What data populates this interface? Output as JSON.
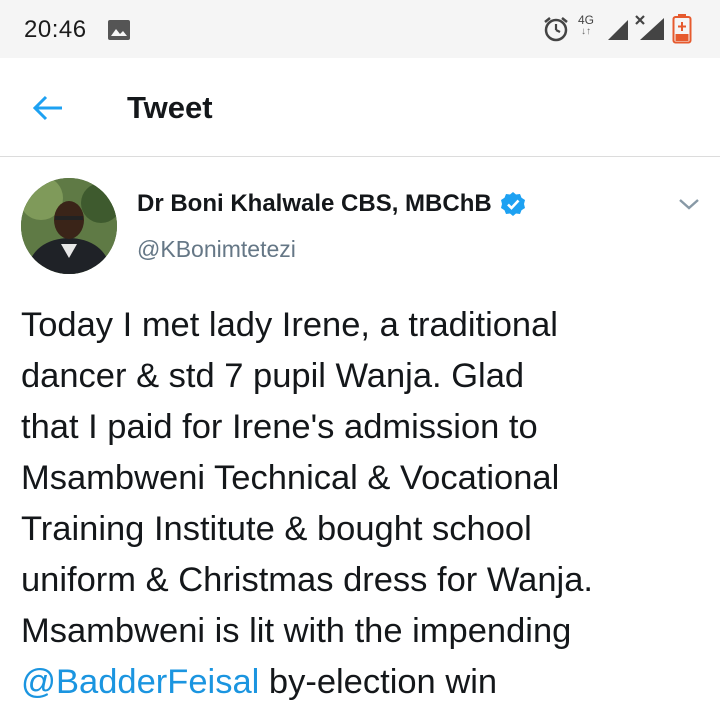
{
  "status_bar": {
    "time": "20:46",
    "network_type": "4G",
    "network_arrows": "↓↑",
    "icons": [
      "gallery-icon",
      "alarm-icon",
      "signal-icon",
      "signal-no-data-icon",
      "battery-low-icon"
    ]
  },
  "header": {
    "title": "Tweet",
    "back_icon": "arrow-left-icon",
    "accent_color": "#1DA1F2"
  },
  "tweet": {
    "author_name": "Dr Boni Khalwale CBS, MBChB",
    "verified": true,
    "handle": "@KBonimtetezi",
    "text_lines": [
      "Today I met lady Irene, a traditional",
      "dancer & std 7 pupil Wanja. Glad",
      "that I paid for Irene's admission to",
      "Msambweni Technical & Vocational",
      "Training Institute & bought school",
      "uniform & Christmas dress for Wanja.",
      "Msambweni is lit with the impending"
    ],
    "mention": "@BadderFeisal",
    "last_line_rest": " by-election win",
    "mention_color": "#1B95E0"
  }
}
